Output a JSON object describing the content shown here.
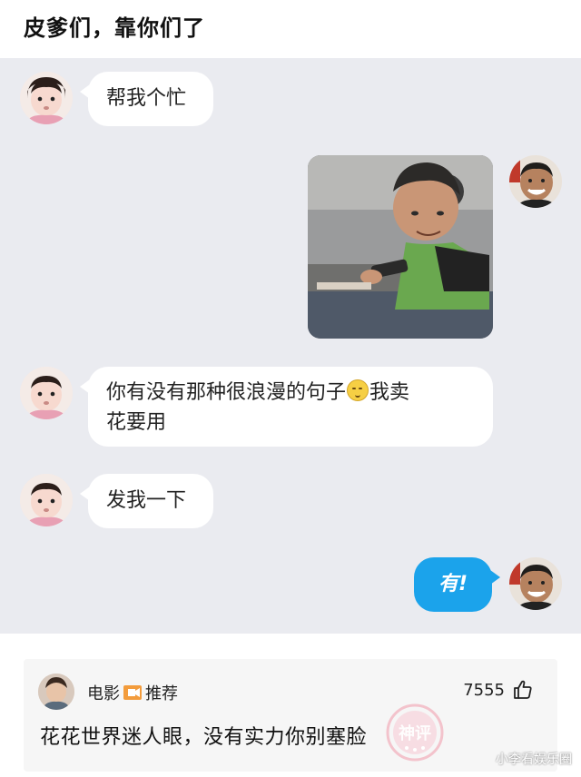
{
  "post": {
    "title": "皮爹们，靠你们了"
  },
  "chat": {
    "messages": [
      {
        "side": "left",
        "text": "帮我个忙"
      },
      {
        "side": "right",
        "type": "image"
      },
      {
        "side": "left",
        "text_part1": "你有没有那种很浪漫的句子",
        "emoji": "smile-emoji",
        "text_part2": "我卖",
        "text_line2": "花要用"
      },
      {
        "side": "left",
        "text": "发我一下"
      },
      {
        "side": "right",
        "text": "有!"
      }
    ]
  },
  "comment": {
    "user": "电影",
    "tag": "推荐",
    "likes": "7555",
    "text": "花花世界迷人眼，没有实力你别塞脸",
    "stamp_text": "神评"
  },
  "watermark": "小李看娱乐圈",
  "colors": {
    "chat_bg": "#eaebf0",
    "bubble_white": "#ffffff",
    "bubble_blue": "#1ba3eb",
    "card_bg": "#f6f6f6",
    "stamp": "#f0a0b0"
  },
  "icons": [
    "thumbs-up-icon",
    "film-icon",
    "smile-emoji-icon"
  ]
}
